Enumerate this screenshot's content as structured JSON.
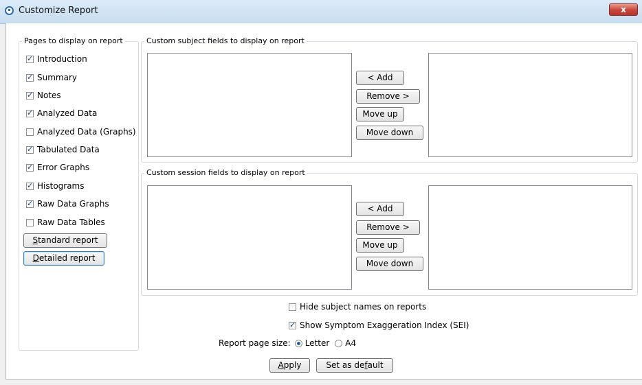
{
  "window": {
    "title": "Customize Report",
    "close_label": "x"
  },
  "pages_panel": {
    "legend": "Pages to display on report",
    "items": [
      {
        "label": "Introduction",
        "checked": true
      },
      {
        "label": "Summary",
        "checked": true
      },
      {
        "label": "Notes",
        "checked": true
      },
      {
        "label": "Analyzed Data",
        "checked": true
      },
      {
        "label": "Analyzed Data (Graphs)",
        "checked": false
      },
      {
        "label": "Tabulated Data",
        "checked": true
      },
      {
        "label": "Error Graphs",
        "checked": true
      },
      {
        "label": "Histograms",
        "checked": true
      },
      {
        "label": "Raw Data Graphs",
        "checked": true
      },
      {
        "label": "Raw Data Tables",
        "checked": false
      }
    ],
    "standard_report": {
      "mnemonic": "S",
      "rest": "tandard report"
    },
    "detailed_report": {
      "mnemonic": "D",
      "rest": "etailed report"
    }
  },
  "subject_fields": {
    "legend": "Custom subject fields to display on report",
    "add": "< Add",
    "remove": "Remove >",
    "move_up": "Move up",
    "move_down": "Move down"
  },
  "session_fields": {
    "legend": "Custom session fields to display on report",
    "add": "< Add",
    "remove": "Remove >",
    "move_up": "Move up",
    "move_down": "Move down"
  },
  "options": {
    "hide_names": {
      "label": "Hide subject names on reports",
      "checked": false
    },
    "show_sei": {
      "label": "Show Symptom Exaggeration Index (SEI)",
      "checked": true
    },
    "page_size_label": "Report page size:",
    "page_sizes": [
      {
        "label": "Letter",
        "selected": true
      },
      {
        "label": "A4",
        "selected": false
      }
    ]
  },
  "actions": {
    "apply": {
      "mnemonic": "A",
      "rest": "pply"
    },
    "set_default": {
      "pre": "Set as de",
      "mnemonic": "f",
      "post": "ault"
    }
  }
}
